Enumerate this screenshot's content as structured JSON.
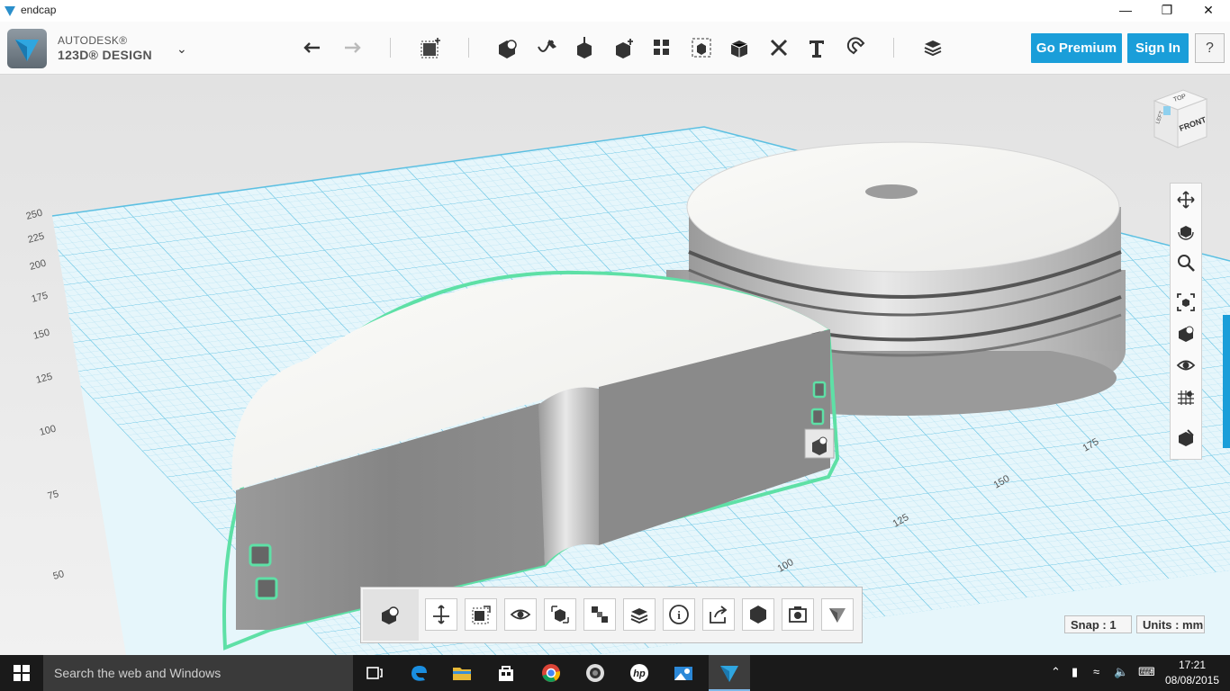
{
  "window": {
    "title": "endcap"
  },
  "app": {
    "brand_top": "AUTODESK®",
    "brand_bottom": "123D® DESIGN"
  },
  "toolbar": {
    "undo_icon": "undo-arrow-icon",
    "redo_icon": "redo-arrow-icon",
    "tools": [
      "transform",
      "primitives",
      "sketch",
      "construct",
      "modify",
      "pattern",
      "grouping",
      "combine",
      "measure",
      "text",
      "snap",
      "material"
    ],
    "go_premium": "Go Premium",
    "sign_in": "Sign In",
    "help": "?"
  },
  "viewcube": {
    "top_label": "TOP",
    "front_label": "FRONT",
    "left_label": "LEFT"
  },
  "grid": {
    "y_ticks": [
      "250",
      "225",
      "200",
      "175",
      "150",
      "125",
      "100",
      "75",
      "50"
    ],
    "x_ticks": [
      "100",
      "125",
      "150",
      "175"
    ]
  },
  "colors": {
    "accent": "#1a9ed9",
    "grid_line": "#6bc8e6",
    "selection": "#5ee0a6"
  },
  "status": {
    "snap": "Snap : 1",
    "units": "Units : mm"
  },
  "taskbar": {
    "search_placeholder": "Search the web and Windows",
    "time": "17:21",
    "date": "08/08/2015"
  }
}
